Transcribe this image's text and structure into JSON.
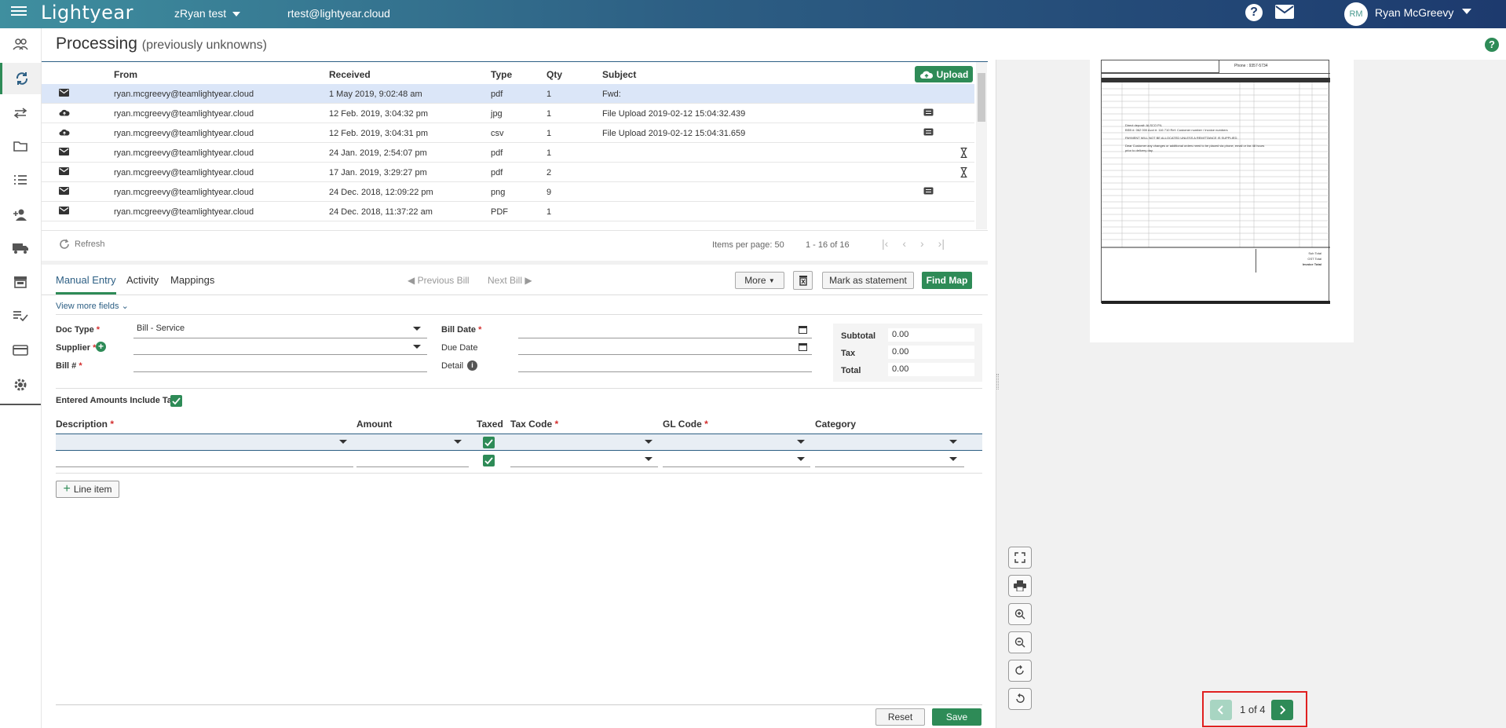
{
  "topbar": {
    "logo": "Lightyear",
    "org": "zRyan test",
    "email": "rtest@lightyear.cloud",
    "help": "?",
    "avatar_initials": "RM",
    "username": "Ryan McGreevy"
  },
  "sidebar": {
    "items": [
      "contacts-icon",
      "processing-icon",
      "transfers-icon",
      "folder-icon",
      "list-icon",
      "add-user-icon",
      "truck-icon",
      "store-icon",
      "approve-list-icon",
      "card-icon",
      "settings-icon"
    ]
  },
  "header": {
    "title": "Processing",
    "subtitle": "(previously unknowns)",
    "help": "?"
  },
  "table": {
    "columns": {
      "from": "From",
      "received": "Received",
      "type": "Type",
      "qty": "Qty",
      "subject": "Subject"
    },
    "upload_label": "Upload",
    "rows": [
      {
        "icon": "mail",
        "from": "ryan.mcgreevy@teamlightyear.cloud",
        "received": "1 May 2019, 9:02:48 am",
        "type": "pdf",
        "qty": "1",
        "subject": "Fwd:",
        "status": ""
      },
      {
        "icon": "upload",
        "from": "ryan.mcgreevy@teamlightyear.cloud",
        "received": "12 Feb. 2019, 3:04:32 pm",
        "type": "jpg",
        "qty": "1",
        "subject": "File Upload 2019-02-12 15:04:32.439",
        "status": "note"
      },
      {
        "icon": "upload",
        "from": "ryan.mcgreevy@teamlightyear.cloud",
        "received": "12 Feb. 2019, 3:04:31 pm",
        "type": "csv",
        "qty": "1",
        "subject": "File Upload 2019-02-12 15:04:31.659",
        "status": "note"
      },
      {
        "icon": "mail",
        "from": "ryan.mcgreevy@teamlightyear.cloud",
        "received": "24 Jan. 2019, 2:54:07 pm",
        "type": "pdf",
        "qty": "1",
        "subject": "",
        "status": "hourglass"
      },
      {
        "icon": "mail",
        "from": "ryan.mcgreevy@teamlightyear.cloud",
        "received": "17 Jan. 2019, 3:29:27 pm",
        "type": "pdf",
        "qty": "2",
        "subject": "",
        "status": "hourglass"
      },
      {
        "icon": "mail",
        "from": "ryan.mcgreevy@teamlightyear.cloud",
        "received": "24 Dec. 2018, 12:09:22 pm",
        "type": "png",
        "qty": "9",
        "subject": "",
        "status": "note"
      },
      {
        "icon": "mail",
        "from": "ryan.mcgreevy@teamlightyear.cloud",
        "received": "24 Dec. 2018, 11:37:22 am",
        "type": "PDF",
        "qty": "1",
        "subject": "",
        "status": ""
      }
    ]
  },
  "pager": {
    "refresh": "Refresh",
    "items_per_page": "Items per page: 50",
    "range": "1 - 16 of 16"
  },
  "tabs": [
    "Manual Entry",
    "Activity",
    "Mappings"
  ],
  "bill_nav": {
    "prev": "Previous Bill",
    "next": "Next Bill"
  },
  "actions": {
    "more": "More",
    "mark_statement": "Mark as statement",
    "find_map": "Find Map"
  },
  "form": {
    "view_more": "View more fields",
    "doc_type_label": "Doc Type",
    "doc_type_value": "Bill - Service",
    "supplier_label": "Supplier",
    "bill_num_label": "Bill #",
    "bill_date_label": "Bill Date",
    "due_date_label": "Due Date",
    "detail_label": "Detail",
    "subtotal_label": "Subtotal",
    "subtotal_value": "0.00",
    "tax_label": "Tax",
    "tax_value": "0.00",
    "total_label": "Total",
    "total_value": "0.00",
    "include_tax_label": "Entered Amounts Include Tax"
  },
  "line_items": {
    "headers": {
      "description": "Description",
      "amount": "Amount",
      "taxed": "Taxed",
      "tax_code": "Tax Code",
      "gl_code": "GL Code",
      "category": "Category"
    },
    "add_label": "Line item"
  },
  "footer": {
    "reset": "Reset",
    "save": "Save"
  },
  "preview": {
    "page_indicator": "1 of 4",
    "doc_phone": "Phone : 9357-5734",
    "doc_lines": [
      "Direct deposit: ALSCO P/L",
      "BSB #: 062 000   Acct #: 116 710   Ref: Customer number / Invoice numbers",
      "PAYMENT WILL NOT BE ALLOCATED UNLESS A REMITTANCE IS SUPPLIED.",
      "Dear Customer any changes or additional orders need to be placed via phone, email or fax 48 hours",
      "prior to delivery day."
    ],
    "doc_totals": [
      "Sub Total",
      "GST Total",
      "Invoice Total"
    ]
  },
  "colors": {
    "accent": "#2e8b57",
    "brand": "#2d5f84",
    "highlight": "#e02020"
  }
}
